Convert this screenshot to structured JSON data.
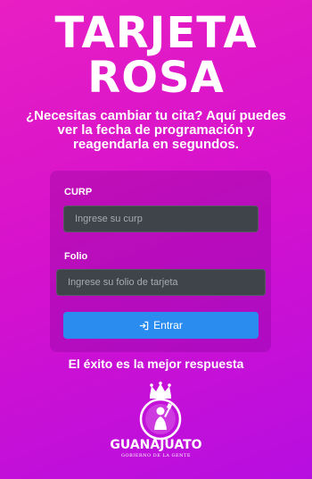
{
  "header": {
    "title_line1": "TARJETA",
    "title_line2": "ROSA",
    "subtitle": "¿Necesitas cambiar tu cita? Aquí puedes ver la fecha de programación y reagendarla en segundos."
  },
  "form": {
    "curp_label": "CURP",
    "curp_placeholder": "Ingrese su curp",
    "curp_value": "",
    "folio_label": "Folio",
    "folio_placeholder": "Ingrese su folio de tarjeta",
    "folio_value": "",
    "submit_label": "Entrar",
    "submit_icon": "login-icon"
  },
  "footer": {
    "motto": "El éxito es la mejor respuesta",
    "logo_name": "GUANAJUATO",
    "logo_sub": "GOBIERNO DE LA GENTE"
  },
  "colors": {
    "background_start": "#e81fc3",
    "background_end": "#b70ee0",
    "button": "#2b8cf0",
    "input_bg": "#3f434a"
  }
}
